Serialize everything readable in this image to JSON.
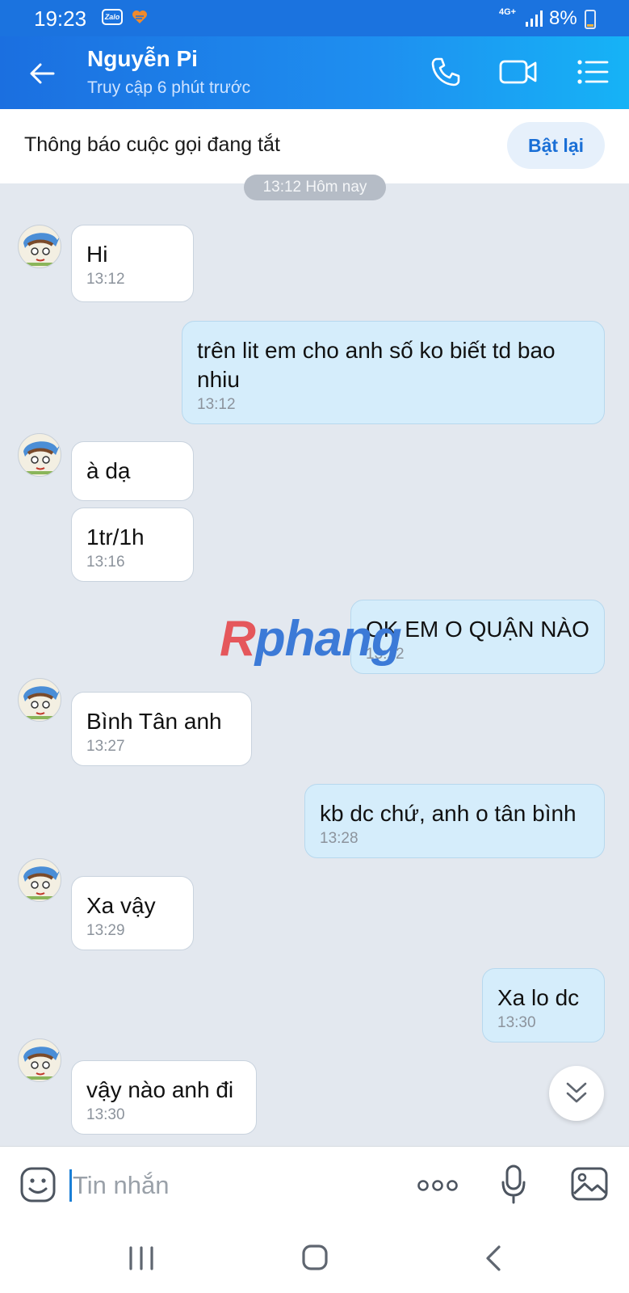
{
  "status_bar": {
    "time": "19:23",
    "app_badge": "Zalo",
    "network": "4G+",
    "battery": "8%"
  },
  "header": {
    "name": "Nguyễn Pi",
    "status": "Truy cập 6 phút trước"
  },
  "notice": {
    "text": "Thông báo cuộc gọi đang tắt",
    "button": "Bật lại"
  },
  "date_divider": "13:12 Hôm nay",
  "messages": [
    {
      "dir": "in",
      "text": "Hi",
      "time": "13:12"
    },
    {
      "dir": "out",
      "text": "trên lit em cho anh số ko biết td bao nhiu",
      "time": "13:12"
    },
    {
      "dir": "in",
      "text": "à dạ",
      "time": ""
    },
    {
      "dir": "in",
      "text": "1tr/1h",
      "time": "13:16"
    },
    {
      "dir": "out",
      "text": "OK EM O QUẬN NÀO",
      "time": "13:22"
    },
    {
      "dir": "in",
      "text": " Bình Tân anh",
      "time": "13:27"
    },
    {
      "dir": "out",
      "text": "kb dc chứ, anh o tân bình",
      "time": "13:28"
    },
    {
      "dir": "in",
      "text": "Xa vậy",
      "time": "13:29"
    },
    {
      "dir": "out",
      "text": "Xa lo dc",
      "time": "13:30"
    },
    {
      "dir": "in",
      "text": "vậy nào anh đi",
      "time": "13:30"
    }
  ],
  "watermark": {
    "part1": "R",
    "part2": "phang"
  },
  "composer": {
    "placeholder": "Tin nhắn"
  },
  "colors": {
    "header_start": "#1b6fe0",
    "header_end": "#16b3f6",
    "bubble_out": "#d5edfb",
    "chat_bg": "#e3e8ef"
  }
}
